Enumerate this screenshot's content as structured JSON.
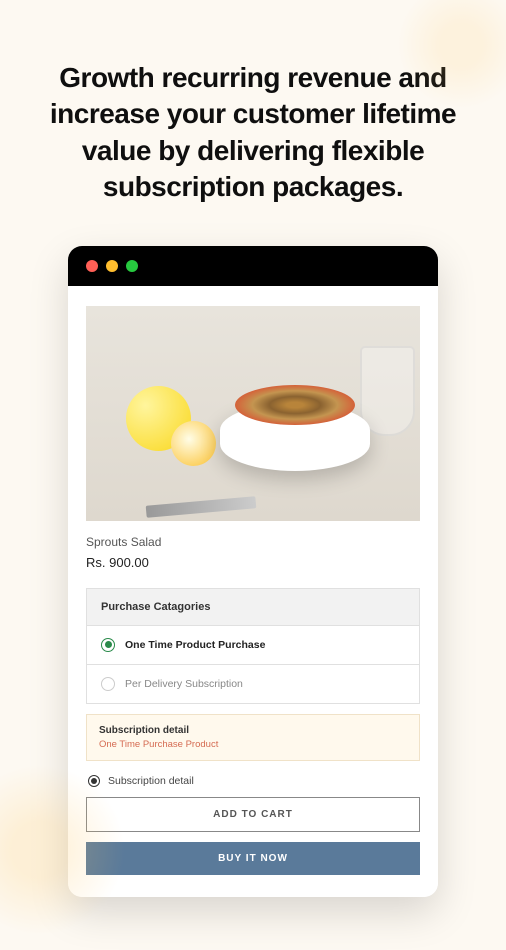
{
  "headline": "Growth recurring revenue and increase your customer lifetime value by delivering flexible subscription packages.",
  "product": {
    "name": "Sprouts Salad",
    "price": "Rs. 900.00"
  },
  "categories": {
    "header": "Purchase Catagories",
    "options": [
      {
        "label": "One Time Product Purchase",
        "selected": true
      },
      {
        "label": "Per Delivery Subscription",
        "selected": false
      }
    ]
  },
  "detail_banner": {
    "title": "Subscription detail",
    "subtitle": "One Time Purchase Product"
  },
  "subscription_detail": {
    "label": "Subscription detail"
  },
  "buttons": {
    "add_to_cart": "ADD TO CART",
    "buy_now": "BUY IT NOW"
  }
}
